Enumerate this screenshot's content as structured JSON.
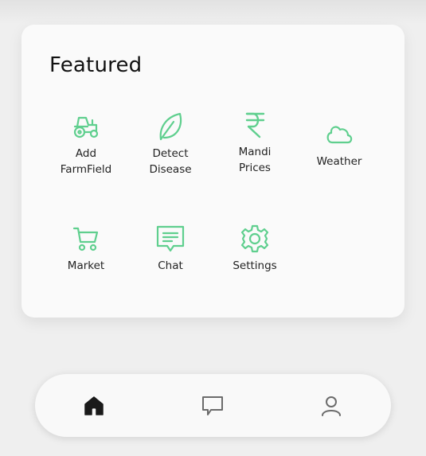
{
  "featured": {
    "title": "Featured",
    "items": [
      {
        "label": "Add\nFarmField",
        "icon": "tractor-icon"
      },
      {
        "label": "Detect\nDisease",
        "icon": "leaf-icon"
      },
      {
        "label": "Mandi\nPrices",
        "icon": "rupee-icon"
      },
      {
        "label": "Weather",
        "icon": "cloud-icon"
      },
      {
        "label": "Market",
        "icon": "cart-icon"
      },
      {
        "label": "Chat",
        "icon": "chat-icon"
      },
      {
        "label": "Settings",
        "icon": "gear-icon"
      }
    ]
  },
  "bottom_nav": {
    "items": [
      {
        "icon": "home-icon",
        "active": true
      },
      {
        "icon": "chat-bubble-icon",
        "active": false
      },
      {
        "icon": "user-icon",
        "active": false
      }
    ]
  },
  "colors": {
    "accent": "#5fcf8e",
    "nav_active": "#1a1a1a",
    "nav_inactive": "#6b6b6b"
  }
}
